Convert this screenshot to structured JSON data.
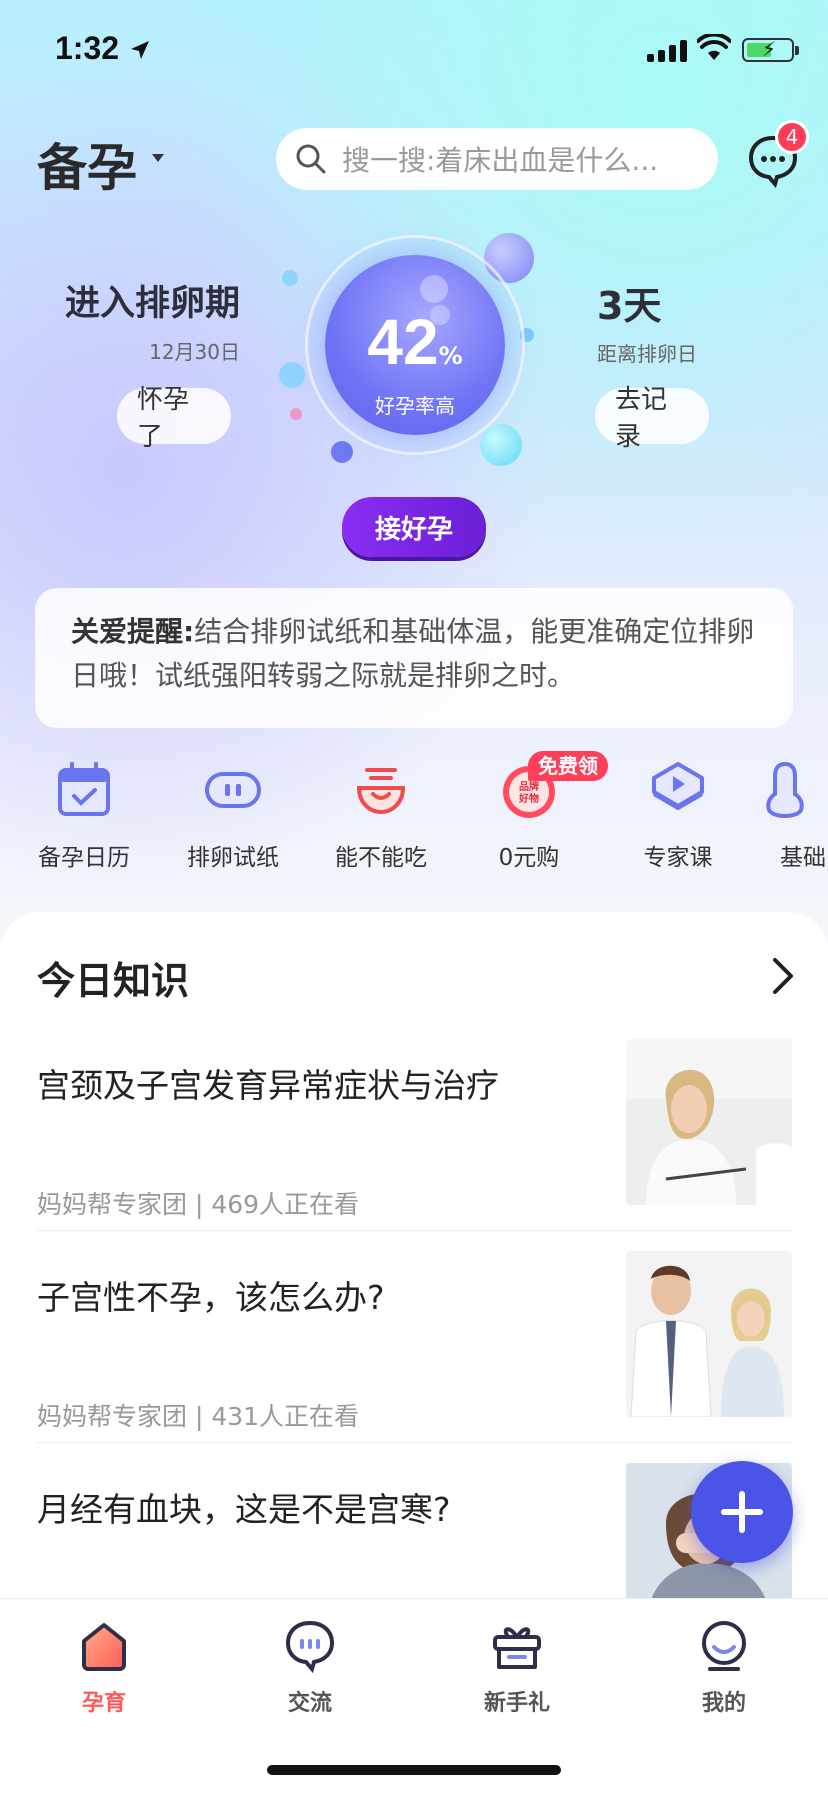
{
  "status_bar": {
    "time": "1:32"
  },
  "header": {
    "mode_title": "备孕",
    "search_placeholder": "搜一搜:着床出血是什么...",
    "message_badge": "4"
  },
  "ovulation": {
    "left_title": "进入排卵期",
    "left_date": "12月30日",
    "pregnant_button": "怀孕了",
    "rate_value": "42",
    "rate_unit": "%",
    "rate_label": "好孕率高",
    "right_title": "3天",
    "right_sub": "距离排卵日",
    "record_button": "去记录",
    "main_button": "接好孕"
  },
  "reminder": {
    "label": "关爱提醒:",
    "text": "结合排卵试纸和基础体温，能更准确定位排卵日哦！试纸强阳转弱之际就是排卵之时。"
  },
  "shortcuts": [
    {
      "label": "备孕日历",
      "icon": "calendar-icon"
    },
    {
      "label": "排卵试纸",
      "icon": "test-strip-icon"
    },
    {
      "label": "能不能吃",
      "icon": "bowl-icon"
    },
    {
      "label": "0元购",
      "icon": "brand-goods-icon",
      "tag": "免费领",
      "icon_text": "品牌好物"
    },
    {
      "label": "专家课",
      "icon": "play-course-icon"
    },
    {
      "label": "基础",
      "icon": "thermometer-icon"
    }
  ],
  "knowledge": {
    "title": "今日知识",
    "articles": [
      {
        "title": "宫颈及子宫发育异常症状与治疗",
        "meta": "妈妈帮专家团 | 469人正在看"
      },
      {
        "title": "子宫性不孕，该怎么办?",
        "meta": "妈妈帮专家团 | 431人正在看"
      },
      {
        "title": "月经有血块，这是不是宫寒?",
        "meta": ""
      }
    ]
  },
  "tabbar": [
    {
      "label": "孕育",
      "icon": "home-icon",
      "active": true
    },
    {
      "label": "交流",
      "icon": "chat-icon",
      "active": false
    },
    {
      "label": "新手礼",
      "icon": "gift-icon",
      "active": false
    },
    {
      "label": "我的",
      "icon": "profile-icon",
      "active": false
    }
  ],
  "colors": {
    "accent_purple": "#7b2ae6",
    "fab_blue": "#4a55e8",
    "active_tab": "#ff5a5a",
    "badge_red": "#ff3b55"
  }
}
